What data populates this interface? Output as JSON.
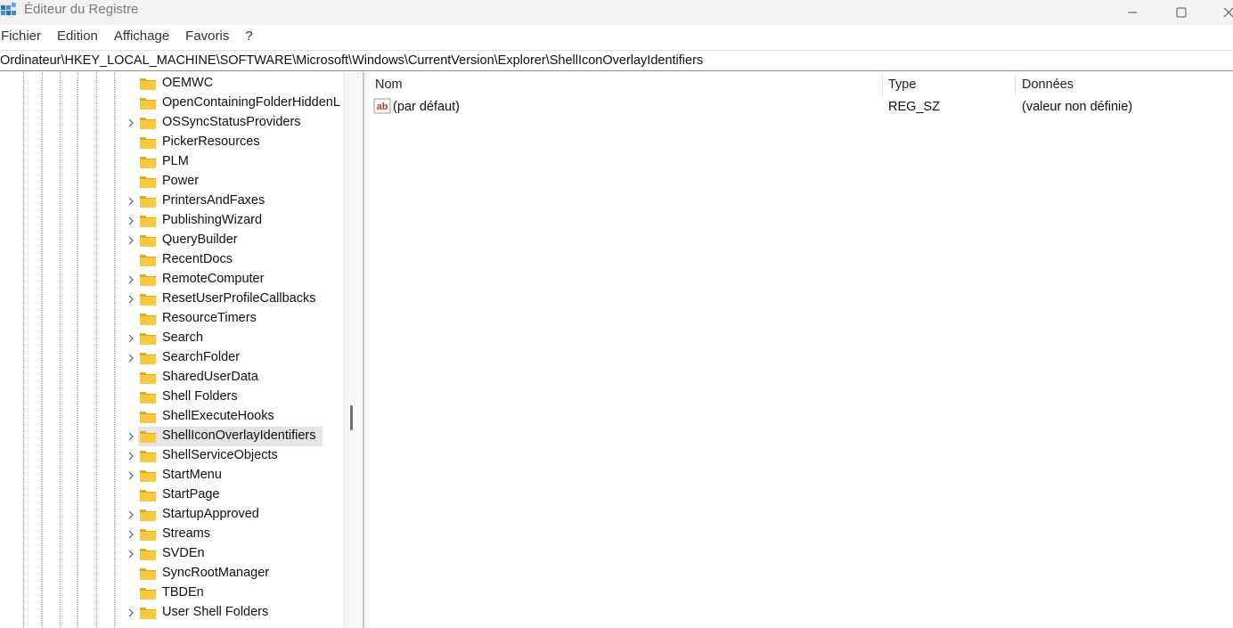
{
  "window": {
    "title": "Éditeur du Registre"
  },
  "menu": [
    "Fichier",
    "Edition",
    "Affichage",
    "Favoris",
    "?"
  ],
  "address": "Ordinateur\\HKEY_LOCAL_MACHINE\\SOFTWARE\\Microsoft\\Windows\\CurrentVersion\\Explorer\\ShellIconOverlayIdentifiers",
  "tree": {
    "items": [
      {
        "label": "OEMWC",
        "expandable": false
      },
      {
        "label": "OpenContainingFolderHiddenL",
        "expandable": false
      },
      {
        "label": "OSSyncStatusProviders",
        "expandable": true
      },
      {
        "label": "PickerResources",
        "expandable": false
      },
      {
        "label": "PLM",
        "expandable": false
      },
      {
        "label": "Power",
        "expandable": false
      },
      {
        "label": "PrintersAndFaxes",
        "expandable": true
      },
      {
        "label": "PublishingWizard",
        "expandable": true
      },
      {
        "label": "QueryBuilder",
        "expandable": true
      },
      {
        "label": "RecentDocs",
        "expandable": false
      },
      {
        "label": "RemoteComputer",
        "expandable": true
      },
      {
        "label": "ResetUserProfileCallbacks",
        "expandable": true
      },
      {
        "label": "ResourceTimers",
        "expandable": false
      },
      {
        "label": "Search",
        "expandable": true
      },
      {
        "label": "SearchFolder",
        "expandable": true
      },
      {
        "label": "SharedUserData",
        "expandable": false
      },
      {
        "label": "Shell Folders",
        "expandable": false
      },
      {
        "label": "ShellExecuteHooks",
        "expandable": false
      },
      {
        "label": "ShellIconOverlayIdentifiers",
        "expandable": true,
        "selected": true
      },
      {
        "label": "ShellServiceObjects",
        "expandable": true
      },
      {
        "label": "StartMenu",
        "expandable": true
      },
      {
        "label": "StartPage",
        "expandable": false
      },
      {
        "label": "StartupApproved",
        "expandable": true
      },
      {
        "label": "Streams",
        "expandable": true
      },
      {
        "label": "SVDEn",
        "expandable": true
      },
      {
        "label": "SyncRootManager",
        "expandable": false
      },
      {
        "label": "TBDEn",
        "expandable": false
      },
      {
        "label": "User Shell Folders",
        "expandable": true
      }
    ]
  },
  "list": {
    "columns": {
      "name": "Nom",
      "type": "Type",
      "data": "Données"
    },
    "rows": [
      {
        "name": "(par défaut)",
        "type": "REG_SZ",
        "data": "(valeur non définie)"
      }
    ]
  },
  "colors": {
    "folder": "#f8c93c",
    "folder_dark": "#e2a91a",
    "selected_bg": "#e5e5e5",
    "titlebar_bg": "#f3f3f3",
    "app_icon_blue": "#1f6fd1"
  }
}
